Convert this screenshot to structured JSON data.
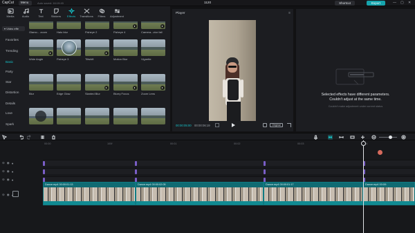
{
  "titlebar": {
    "logo": "CapCut",
    "menu": "Menu",
    "autosave": "Auto saved: 16:19:45",
    "title": "1120",
    "shortcut": "Shortcut",
    "export": "Export",
    "controls": [
      "—",
      "▢",
      "✕"
    ]
  },
  "toolbar": {
    "tabs": [
      {
        "label": "Media",
        "icon": "media-icon"
      },
      {
        "label": "Audio",
        "icon": "audio-icon"
      },
      {
        "label": "Text",
        "icon": "text-icon"
      },
      {
        "label": "Stickers",
        "icon": "stickers-icon"
      },
      {
        "label": "Effects",
        "icon": "effects-icon",
        "active": true
      },
      {
        "label": "Transitions",
        "icon": "transitions-icon"
      },
      {
        "label": "Filters",
        "icon": "filters-icon"
      },
      {
        "label": "Adjustment",
        "icon": "adjustment-icon"
      }
    ]
  },
  "sidebar": {
    "header": "▾ Video effe",
    "items": [
      {
        "label": "Favorites"
      },
      {
        "label": "Trending"
      },
      {
        "label": "Basic",
        "active": true
      },
      {
        "label": "Party"
      },
      {
        "label": "Star"
      },
      {
        "label": "Distortion"
      },
      {
        "label": "Details"
      },
      {
        "label": "Love"
      },
      {
        "label": "Spark"
      }
    ]
  },
  "effects": {
    "rows": [
      [
        "Glamo... zoom",
        "Halo blur",
        "Fisheye 2",
        "Fisheye 4",
        "Camera...ctor fall"
      ],
      [
        "Wide Angle",
        "Fisheye 3",
        "Tiltshift",
        "Motion Blur",
        "Vignette"
      ],
      [
        "Blur",
        "Edge Glow",
        "Slanted Blur",
        "Blurry Focus",
        "Zoom Lens"
      ],
      [
        "",
        "",
        "",
        "",
        ""
      ]
    ]
  },
  "player": {
    "title": "Player",
    "current": "00:00:05:00",
    "duration": "00:00:06:19",
    "original": "Original"
  },
  "details": {
    "message_line1": "Selected effects have different parameters.",
    "message_line2": "Couldn't adjust at the same time.",
    "sub": "Couldn't make adjustment under current status"
  },
  "timeline": {
    "ruler": [
      "00:00",
      "100f",
      "00:01",
      "00:02",
      "00:03",
      "00:04"
    ],
    "clips": [
      {
        "name": "Dance.mp4",
        "dur": "00:00:01:13"
      },
      {
        "name": "Dance.mp4",
        "dur": "00:00:02:05"
      },
      {
        "name": "Dance.mp4",
        "dur": "00:00:01:17"
      },
      {
        "name": "Dance.mp4",
        "dur": "00:00:"
      }
    ],
    "cover": "Cover"
  }
}
